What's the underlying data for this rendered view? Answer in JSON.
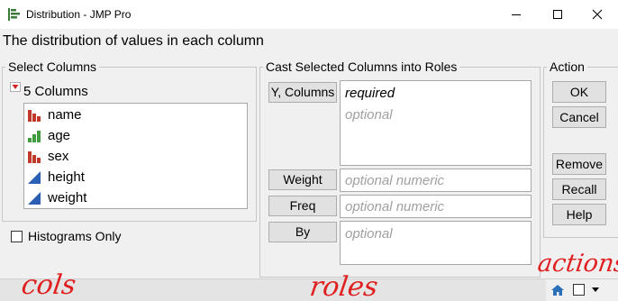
{
  "window": {
    "title": "Distribution - JMP Pro",
    "icon": "distribution-chart-icon",
    "controls": [
      "minimize-icon",
      "maximize-icon",
      "close-icon"
    ]
  },
  "subtitle": "The distribution of values in each column",
  "select_columns": {
    "label": "Select Columns",
    "count_label": "5 Columns",
    "columns": [
      {
        "name": "name",
        "type": "nominal",
        "icon": "nominal-bars-icon",
        "color": "#c0392b"
      },
      {
        "name": "age",
        "type": "ordinal",
        "icon": "ordinal-bars-icon",
        "color": "#3f9c3f"
      },
      {
        "name": "sex",
        "type": "nominal",
        "icon": "nominal-bars-icon",
        "color": "#c0392b"
      },
      {
        "name": "height",
        "type": "continuous",
        "icon": "continuous-triangle-icon",
        "color": "#2b5fb3"
      },
      {
        "name": "weight",
        "type": "continuous",
        "icon": "continuous-triangle-icon",
        "color": "#2b5fb3"
      }
    ],
    "histograms_only": {
      "label": "Histograms Only",
      "checked": false
    }
  },
  "cast_roles": {
    "label": "Cast Selected Columns into Roles",
    "roles": [
      {
        "button": "Y, Columns",
        "hints": [
          "required",
          "optional"
        ]
      },
      {
        "button": "Weight",
        "hints": [
          "optional numeric"
        ]
      },
      {
        "button": "Freq",
        "hints": [
          "optional numeric"
        ]
      },
      {
        "button": "By",
        "hints": [
          "optional"
        ]
      }
    ]
  },
  "action": {
    "label": "Action",
    "buttons": [
      "OK",
      "Cancel",
      "Remove",
      "Recall",
      "Help"
    ]
  },
  "annotations": {
    "cols": "cols",
    "roles": "roles",
    "actions": "actions",
    "color": "#e02020"
  }
}
